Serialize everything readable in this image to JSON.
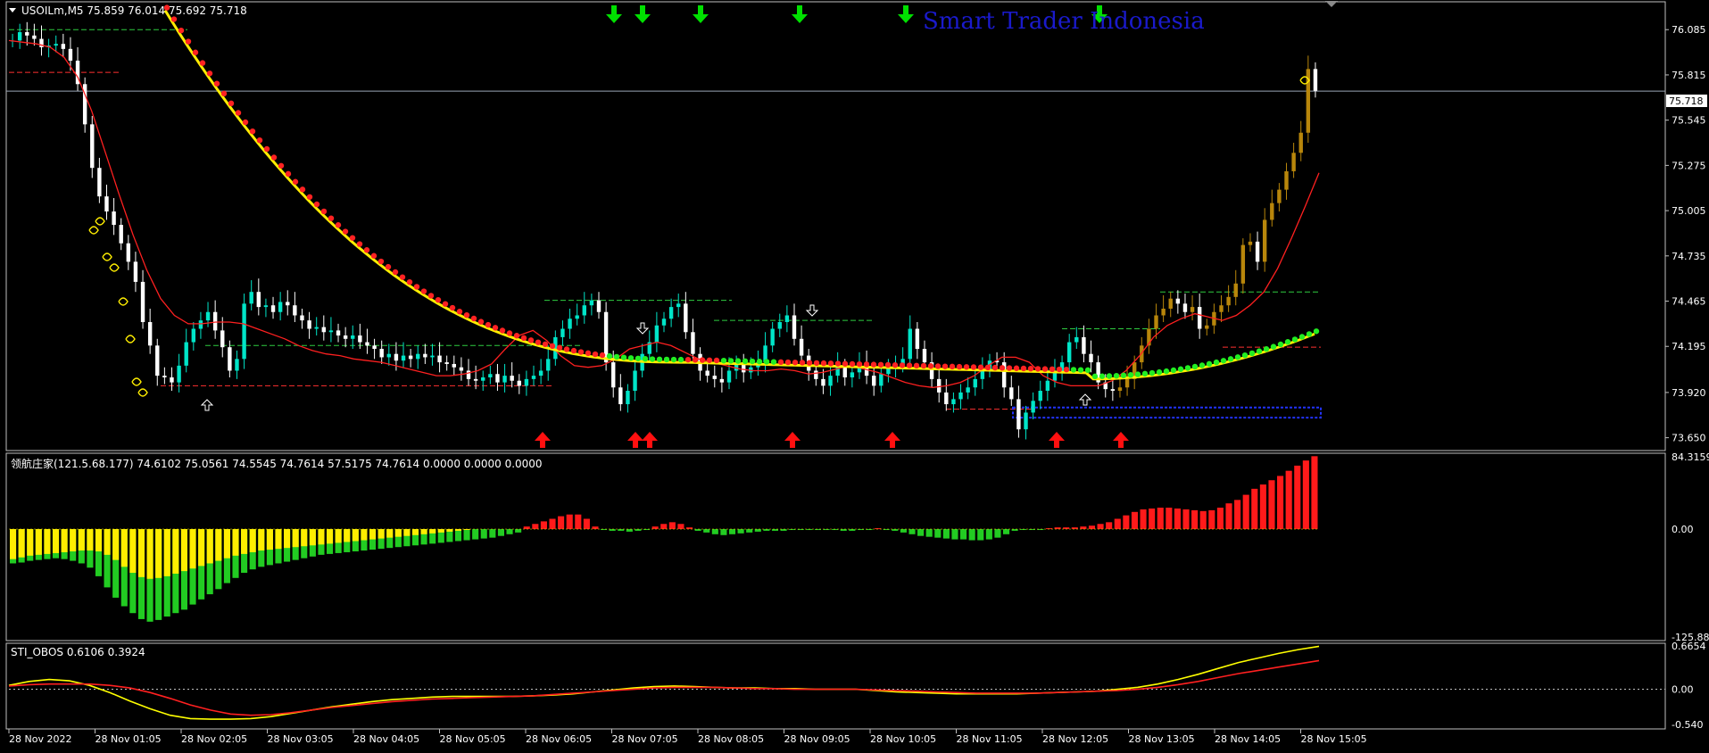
{
  "header": {
    "symbol_line": "USOILm,M5  75.859 76.014 75.692 75.718",
    "watermark": "Smart Trader Indonesia"
  },
  "current_price_label": "75.718",
  "chart_data": [
    {
      "type": "candlestick",
      "symbol": "USOILm",
      "timeframe": "M5",
      "ohlc_current": {
        "open": 75.859,
        "high": 76.014,
        "low": 75.692,
        "close": 75.718
      },
      "ylim": [
        73.6,
        76.23
      ],
      "y_ticks": [
        "76.085",
        "75.815",
        "75.545",
        "75.275",
        "75.005",
        "74.735",
        "74.465",
        "74.195",
        "73.920",
        "73.650"
      ],
      "close_series": [
        76.02,
        76.07,
        76.05,
        76.03,
        75.98,
        75.99,
        76.0,
        75.97,
        75.9,
        75.76,
        75.52,
        75.26,
        75.09,
        75.0,
        74.92,
        74.81,
        74.7,
        74.58,
        74.34,
        74.2,
        74.02,
        74.01,
        73.98,
        74.08,
        74.22,
        74.3,
        74.35,
        74.4,
        74.29,
        74.19,
        74.05,
        74.12,
        74.45,
        74.52,
        74.43,
        74.44,
        74.4,
        74.46,
        74.44,
        74.38,
        74.35,
        74.3,
        74.31,
        74.28,
        74.29,
        74.26,
        74.24,
        74.26,
        74.22,
        74.2,
        74.18,
        74.13,
        74.15,
        74.11,
        74.14,
        74.12,
        74.15,
        74.13,
        74.14,
        74.1,
        74.09,
        74.07,
        74.05,
        74.0,
        73.99,
        74.01,
        74.03,
        73.98,
        74.02,
        73.99,
        73.96,
        74.0,
        74.02,
        74.05,
        74.12,
        74.25,
        74.3,
        74.36,
        74.38,
        74.44,
        74.47,
        74.4,
        74.1,
        73.95,
        73.85,
        73.93,
        74.05,
        74.15,
        74.22,
        74.32,
        74.36,
        74.43,
        74.45,
        74.28,
        74.15,
        74.05,
        74.02,
        74.0,
        73.98,
        74.05,
        74.1,
        74.04,
        74.07,
        74.1,
        74.2,
        74.3,
        74.34,
        74.38,
        74.24,
        74.14,
        74.05,
        74.0,
        73.96,
        74.02,
        74.08,
        74.01,
        74.04,
        74.1,
        74.02,
        73.96,
        74.03,
        74.07,
        74.08,
        74.12,
        74.3,
        74.18,
        74.1,
        74.0,
        73.92,
        73.85,
        73.88,
        73.92,
        73.95,
        74.0,
        74.05,
        74.11,
        74.1,
        73.95,
        73.88,
        73.7,
        73.8,
        73.87,
        73.93,
        73.99,
        74.04,
        74.1,
        74.22,
        74.25,
        74.15,
        74.1,
        73.98,
        73.94,
        73.93,
        73.95,
        74.0,
        74.1,
        74.2,
        74.3,
        74.38,
        74.42,
        74.48,
        74.45,
        74.4,
        74.43,
        74.3,
        74.32,
        74.4,
        74.44,
        74.49,
        74.57,
        74.8,
        74.82,
        74.7,
        74.95,
        75.05,
        75.13,
        75.24,
        75.35,
        75.47,
        75.85,
        75.72
      ],
      "ma_red": [
        76.02,
        76.01,
        76.0,
        75.98,
        75.92,
        75.8,
        75.6,
        75.35,
        75.1,
        74.86,
        74.65,
        74.48,
        74.38,
        74.33,
        74.33,
        74.34,
        74.34,
        74.33,
        74.3,
        74.27,
        74.24,
        74.2,
        74.17,
        74.15,
        74.14,
        74.12,
        74.11,
        74.1,
        74.08,
        74.06,
        74.04,
        74.02,
        74.02,
        74.03,
        74.05,
        74.09,
        74.18,
        74.26,
        74.29,
        74.23,
        74.14,
        74.08,
        74.07,
        74.08,
        74.12,
        74.18,
        74.2,
        74.22,
        74.2,
        74.16,
        74.12,
        74.1,
        74.08,
        74.06,
        74.05,
        74.05,
        74.06,
        74.05,
        74.03,
        74.04,
        74.06,
        74.08,
        74.06,
        74.04,
        74.01,
        73.98,
        73.96,
        73.95,
        73.96,
        73.98,
        74.02,
        74.08,
        74.13,
        74.13,
        74.1,
        74.02,
        73.98,
        73.96,
        73.96,
        73.96,
        73.99,
        74.05,
        74.14,
        74.25,
        74.32,
        74.36,
        74.39,
        74.37,
        74.35,
        74.38,
        74.44,
        74.52,
        74.66,
        74.84,
        75.03,
        75.23
      ],
      "ma_yellow_start": 76.2,
      "ma_yellow_end": 74.28,
      "annotations": {
        "arrow_up_count": 9,
        "arrow_down_count": 6,
        "candle_up_color": "#00e5c8",
        "candle_down_color": "#ffffff",
        "candle_bull_late_color": "#b8860b"
      }
    },
    {
      "type": "bar",
      "title": "领航庄家(121.5.68.177) 74.6102 75.0561 74.5545 74.7614 57.5175 74.7614 0.0000 0.0000 0.0000",
      "ylim": [
        -125.881,
        84.3159
      ],
      "y_ticks": [
        "84.3159",
        "0.00",
        "-125.881"
      ],
      "values": [
        -40,
        -39,
        -37,
        -36,
        -35,
        -34,
        -35,
        -37,
        -40,
        -45,
        -55,
        -68,
        -80,
        -90,
        -98,
        -105,
        -108,
        -106,
        -102,
        -98,
        -94,
        -88,
        -82,
        -76,
        -70,
        -63,
        -57,
        -51,
        -47,
        -44,
        -42,
        -40,
        -38,
        -36,
        -34,
        -32,
        -30,
        -29,
        -28,
        -27,
        -26,
        -25,
        -24,
        -23,
        -22,
        -21,
        -20,
        -19,
        -18,
        -17,
        -16,
        -15,
        -14,
        -13,
        -12,
        -11,
        -10,
        -8,
        -6,
        -4,
        3,
        6,
        9,
        12,
        15,
        17,
        17,
        12,
        3,
        -1,
        -2,
        -2,
        -3,
        -2,
        -1,
        3,
        6,
        8,
        6,
        2,
        -2,
        -4,
        -6,
        -7,
        -6,
        -5,
        -4,
        -3,
        -2,
        -2,
        -2,
        -1,
        -1,
        -1,
        -1,
        -1,
        -1,
        -2,
        -2,
        -1,
        -1,
        1,
        -1,
        -2,
        -4,
        -6,
        -8,
        -9,
        -10,
        -11,
        -12,
        -12,
        -13,
        -13,
        -12,
        -10,
        -6,
        -2,
        -1,
        -1,
        -1,
        1,
        2,
        2,
        2,
        3,
        4,
        6,
        8,
        12,
        16,
        20,
        23,
        24,
        25,
        25,
        24,
        23,
        22,
        21,
        22,
        25,
        30,
        34,
        40,
        47,
        52,
        57,
        62,
        68,
        74,
        80,
        85
      ],
      "yellow_overlay": [
        -35,
        -33,
        -31,
        -30,
        -29,
        -28,
        -27,
        -26,
        -25,
        -25,
        -26,
        -30,
        -36,
        -44,
        -51,
        -56,
        -58,
        -57,
        -55,
        -52,
        -49,
        -46,
        -43,
        -40,
        -37,
        -34,
        -31,
        -29,
        -27,
        -25,
        -24,
        -23,
        -22,
        -21,
        -20,
        -19,
        -18,
        -17,
        -16,
        -15,
        -14,
        -13,
        -12,
        -11,
        -10,
        -9,
        -8,
        -7,
        -6,
        -5,
        -4,
        -3,
        -2,
        -1,
        0,
        0,
        0,
        0,
        0,
        0
      ]
    },
    {
      "type": "line",
      "title": "STI_OBOS 0.6106 0.3924",
      "ylim": [
        -0.5406,
        0.6654
      ],
      "y_ticks": [
        "0.6654",
        "0.00",
        "-0.540"
      ],
      "series": [
        {
          "color": "#ffff00",
          "values": [
            0.06,
            0.12,
            0.15,
            0.13,
            0.06,
            -0.05,
            -0.18,
            -0.3,
            -0.4,
            -0.45,
            -0.46,
            -0.46,
            -0.45,
            -0.42,
            -0.37,
            -0.32,
            -0.27,
            -0.23,
            -0.19,
            -0.16,
            -0.14,
            -0.12,
            -0.11,
            -0.11,
            -0.11,
            -0.11,
            -0.1,
            -0.09,
            -0.07,
            -0.04,
            -0.01,
            0.02,
            0.04,
            0.05,
            0.04,
            0.03,
            0.02,
            0.02,
            0.01,
            0.01,
            0.0,
            0.0,
            0.0,
            -0.02,
            -0.04,
            -0.05,
            -0.06,
            -0.07,
            -0.07,
            -0.07,
            -0.07,
            -0.06,
            -0.05,
            -0.04,
            -0.03,
            0.0,
            0.03,
            0.08,
            0.15,
            0.23,
            0.32,
            0.41,
            0.48,
            0.55,
            0.61,
            0.66
          ]
        },
        {
          "color": "#ff2020",
          "values": [
            0.05,
            0.07,
            0.08,
            0.08,
            0.08,
            0.06,
            0.02,
            -0.05,
            -0.14,
            -0.24,
            -0.32,
            -0.38,
            -0.4,
            -0.39,
            -0.36,
            -0.32,
            -0.28,
            -0.25,
            -0.22,
            -0.19,
            -0.17,
            -0.15,
            -0.14,
            -0.13,
            -0.12,
            -0.11,
            -0.1,
            -0.08,
            -0.06,
            -0.04,
            -0.02,
            0.0,
            0.02,
            0.03,
            0.03,
            0.03,
            0.02,
            0.01,
            0.01,
            0.0,
            0.0,
            0.0,
            0.0,
            -0.01,
            -0.02,
            -0.03,
            -0.04,
            -0.05,
            -0.06,
            -0.06,
            -0.06,
            -0.06,
            -0.05,
            -0.04,
            -0.03,
            -0.02,
            0.0,
            0.03,
            0.07,
            0.12,
            0.18,
            0.24,
            0.29,
            0.34,
            0.39,
            0.44
          ]
        }
      ]
    }
  ],
  "x_axis": {
    "tick_labels": [
      "28 Nov 2022",
      "28 Nov 01:05",
      "28 Nov 02:05",
      "28 Nov 03:05",
      "28 Nov 04:05",
      "28 Nov 05:05",
      "28 Nov 06:05",
      "28 Nov 07:05",
      "28 Nov 08:05",
      "28 Nov 09:05",
      "28 Nov 10:05",
      "28 Nov 11:05",
      "28 Nov 12:05",
      "28 Nov 13:05",
      "28 Nov 14:05",
      "28 Nov 15:05"
    ]
  },
  "colors": {
    "background": "#000000",
    "frame": "#c0c0c0",
    "text": "#ffffff",
    "watermark": "#1a1acc",
    "bull": "#00e5c8",
    "bear": "#ff2020",
    "buy_arrow": "#ff1010",
    "sell_arrow": "#00e000"
  }
}
